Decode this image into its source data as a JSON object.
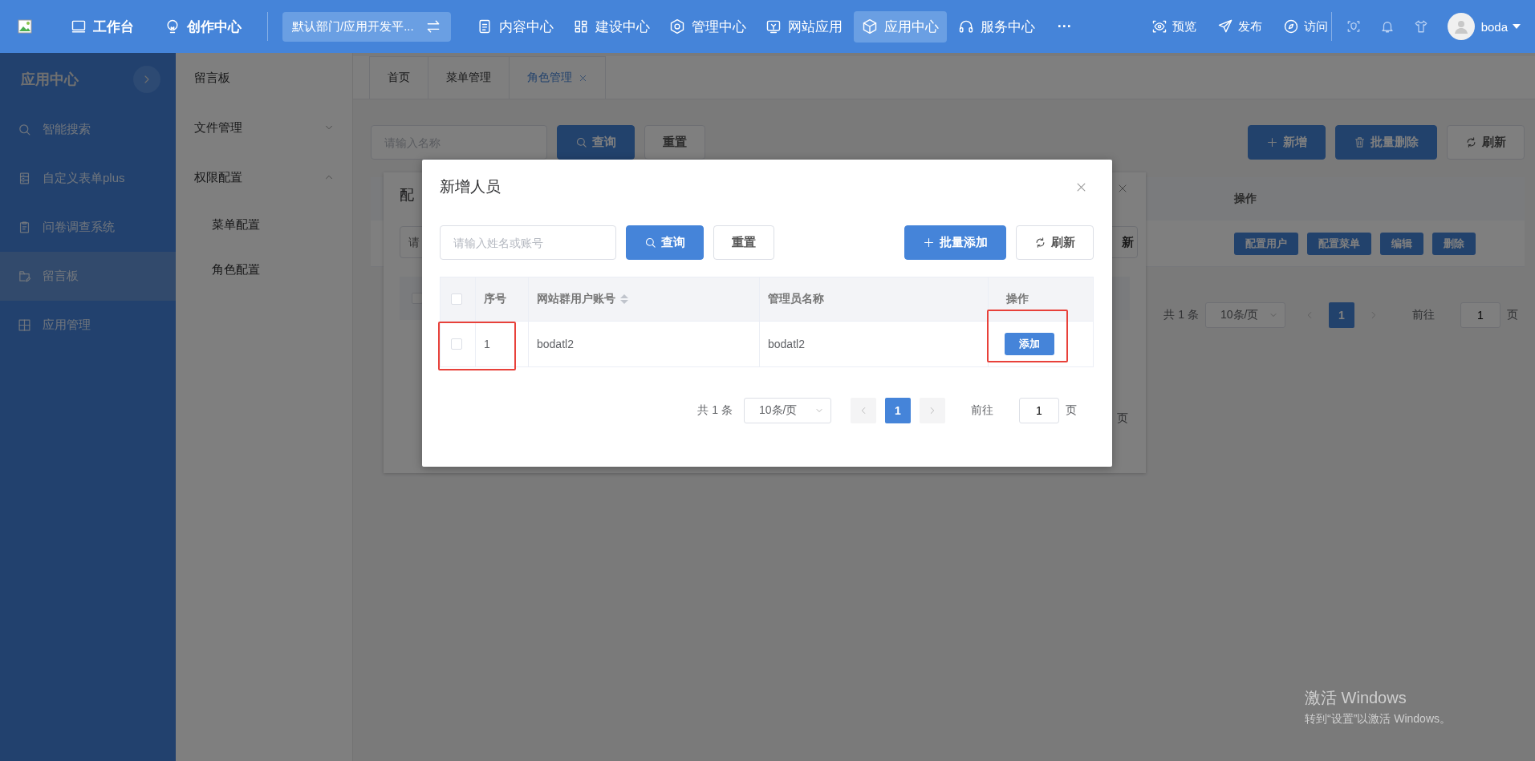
{
  "header": {
    "nav_left": [
      {
        "label": "工作台"
      },
      {
        "label": "创作中心"
      }
    ],
    "dept_selector": "默认部门/应用开发平...",
    "nav": [
      {
        "label": "内容中心",
        "selected": false
      },
      {
        "label": "建设中心",
        "selected": false
      },
      {
        "label": "管理中心",
        "selected": false
      },
      {
        "label": "网站应用",
        "selected": false
      },
      {
        "label": "应用中心",
        "selected": true
      },
      {
        "label": "服务中心",
        "selected": false
      }
    ],
    "more": "···",
    "actions": [
      {
        "label": "预览"
      },
      {
        "label": "发布"
      },
      {
        "label": "访问"
      }
    ],
    "user": "boda"
  },
  "sidebar": {
    "title": "应用中心",
    "items": [
      {
        "label": "智能搜索",
        "selected": false
      },
      {
        "label": "自定义表单plus",
        "selected": false
      },
      {
        "label": "问卷调查系统",
        "selected": false
      },
      {
        "label": "留言板",
        "selected": true
      },
      {
        "label": "应用管理",
        "selected": false
      }
    ]
  },
  "submenu": {
    "items": [
      {
        "label": "留言板"
      },
      {
        "label": "文件管理",
        "expanded": false
      },
      {
        "label": "权限配置",
        "expanded": true,
        "children": [
          {
            "label": "菜单配置"
          },
          {
            "label": "角色配置"
          }
        ]
      }
    ]
  },
  "tabs": [
    {
      "label": "首页",
      "selected": false,
      "closable": false
    },
    {
      "label": "菜单管理",
      "selected": false,
      "closable": false
    },
    {
      "label": "角色管理",
      "selected": true,
      "closable": true
    }
  ],
  "toolbar": {
    "search": {
      "placeholder": "请输入名称"
    },
    "buttons": [
      {
        "label": "查询",
        "kind": "search"
      },
      {
        "label": "重置",
        "kind": "reset"
      }
    ],
    "right_buttons": [
      {
        "label": "新增",
        "kind": "add"
      },
      {
        "label": "批量删除",
        "kind": "delete"
      },
      {
        "label": "刷新",
        "kind": "refresh"
      }
    ]
  },
  "table": {
    "columns": [
      {
        "label": "操作"
      }
    ],
    "rows": [
      {
        "actions": [
          "配置用户",
          "配置菜单",
          "编辑",
          "删除"
        ]
      }
    ]
  },
  "pagination": {
    "total": "共 1 条",
    "page_size": "10条/页",
    "pages": [
      {
        "label": "1",
        "selected": true
      }
    ],
    "goto_label": "前往",
    "goto_value": "1",
    "goto_suffix": "页"
  },
  "back_dialog": {
    "title": "配",
    "search": {
      "placeholder": "请"
    },
    "button": "新",
    "header_checked": false,
    "pagination_suffix": "页"
  },
  "dialog": {
    "title": "新增人员",
    "search": {
      "placeholder": "请输入姓名或账号"
    },
    "buttons": [
      {
        "label": "查询",
        "kind": "search"
      },
      {
        "label": "重置",
        "kind": "reset"
      }
    ],
    "right_buttons": [
      {
        "label": "批量添加",
        "kind": "add"
      },
      {
        "label": "刷新",
        "kind": "refresh"
      }
    ],
    "table": {
      "all_checked": false,
      "columns": [
        {
          "label": "序号",
          "sortable": false
        },
        {
          "label": "网站群用户账号",
          "sortable": true
        },
        {
          "label": "管理员名称",
          "sortable": false
        },
        {
          "label": "操作",
          "sortable": false
        }
      ],
      "rows": [
        {
          "checked": false,
          "index": "1",
          "account": "bodatl2",
          "name": "bodatl2",
          "action": "添加",
          "highlight_select": true,
          "highlight_action": true
        }
      ]
    },
    "pagination": {
      "total": "共 1 条",
      "page_size": "10条/页",
      "pages": [
        {
          "label": "1",
          "selected": true
        }
      ],
      "goto_label": "前往",
      "goto_value": "1",
      "goto_suffix": "页"
    }
  },
  "os_notice": {
    "title": "激活 Windows",
    "text": "转到“设置”以激活 Windows。"
  }
}
